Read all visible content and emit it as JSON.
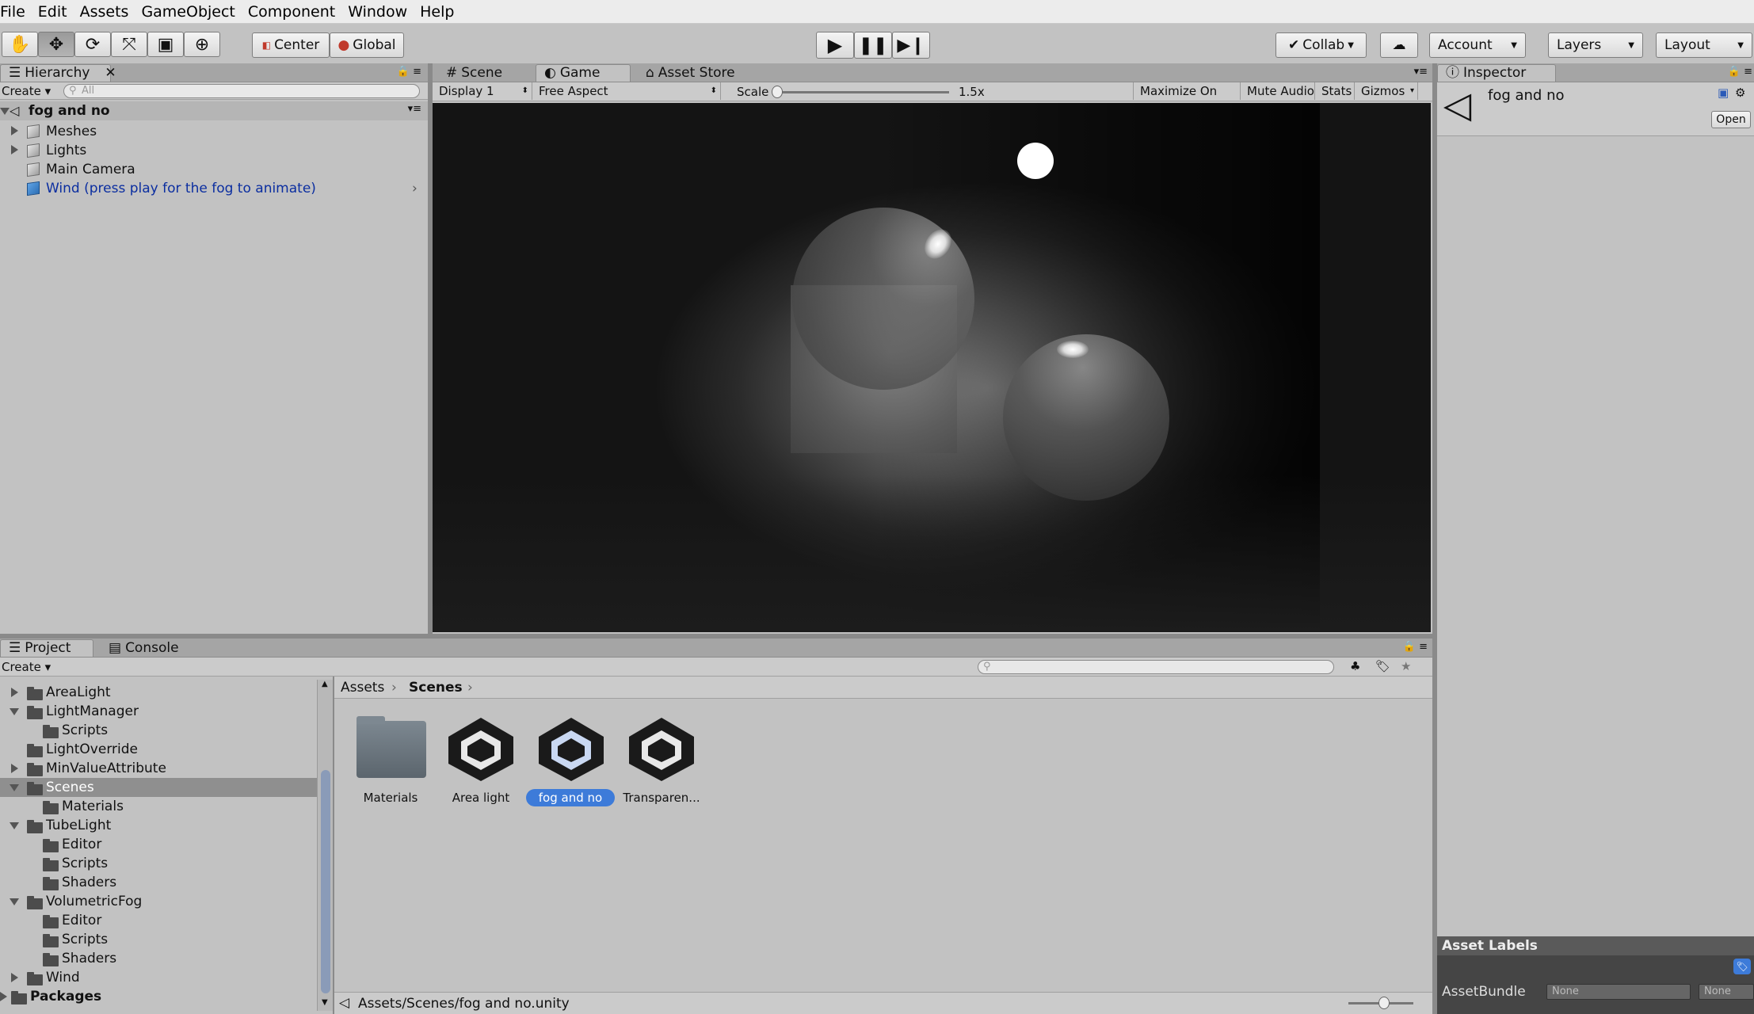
{
  "menu": [
    "File",
    "Edit",
    "Assets",
    "GameObject",
    "Component",
    "Window",
    "Help"
  ],
  "toolbar": {
    "tools": [
      "hand-icon",
      "move-icon",
      "rotate-icon",
      "scale-icon",
      "rect-tool-icon",
      "transform-icon"
    ],
    "pivot": "Center",
    "space": "Global",
    "collab": "Collab",
    "account": "Account",
    "layers": "Layers",
    "layout": "Layout"
  },
  "hierarchy": {
    "tab": "Hierarchy",
    "create": "Create",
    "search_placeholder": "All",
    "scene": "fog and no",
    "items": [
      "Meshes",
      "Lights",
      "Main Camera",
      "Wind (press play for the fog to animate)"
    ]
  },
  "game": {
    "tabs": [
      "Scene",
      "Game",
      "Asset Store"
    ],
    "display": "Display 1",
    "aspect": "Free Aspect",
    "scale_label": "Scale",
    "scale_value": "1.5x",
    "maximize": "Maximize On Play",
    "mute": "Mute Audio",
    "stats": "Stats",
    "gizmos": "Gizmos"
  },
  "inspector": {
    "tab": "Inspector",
    "title": "fog and no",
    "open": "Open",
    "asset_labels": "Asset Labels",
    "asset_bundle": "AssetBundle",
    "bundle_value": "None",
    "variant_value": "None"
  },
  "project": {
    "tabs": [
      "Project",
      "Console"
    ],
    "create": "Create",
    "tree": [
      {
        "label": "AreaLight",
        "level": 0,
        "arrow": "right"
      },
      {
        "label": "LightManager",
        "level": 0,
        "arrow": "down"
      },
      {
        "label": "Scripts",
        "level": 1,
        "arrow": "none"
      },
      {
        "label": "LightOverride",
        "level": 0,
        "arrow": "none"
      },
      {
        "label": "MinValueAttribute",
        "level": 0,
        "arrow": "right"
      },
      {
        "label": "Scenes",
        "level": 0,
        "arrow": "down"
      },
      {
        "label": "Materials",
        "level": 1,
        "arrow": "none"
      },
      {
        "label": "TubeLight",
        "level": 0,
        "arrow": "down"
      },
      {
        "label": "Editor",
        "level": 1,
        "arrow": "none"
      },
      {
        "label": "Scripts",
        "level": 1,
        "arrow": "none"
      },
      {
        "label": "Shaders",
        "level": 1,
        "arrow": "none"
      },
      {
        "label": "VolumetricFog",
        "level": 0,
        "arrow": "down"
      },
      {
        "label": "Editor",
        "level": 1,
        "arrow": "none"
      },
      {
        "label": "Scripts",
        "level": 1,
        "arrow": "none"
      },
      {
        "label": "Shaders",
        "level": 1,
        "arrow": "none"
      },
      {
        "label": "Wind",
        "level": 0,
        "arrow": "right"
      }
    ],
    "packages": "Packages",
    "breadcrumb": [
      "Assets",
      "Scenes"
    ],
    "assets": [
      "Materials",
      "Area light",
      "fog and no",
      "Transparen..."
    ],
    "path": "Assets/Scenes/fog and no.unity"
  },
  "colors": {
    "selection": "#3d7bd9",
    "blue_text": "#0b2ea0"
  }
}
